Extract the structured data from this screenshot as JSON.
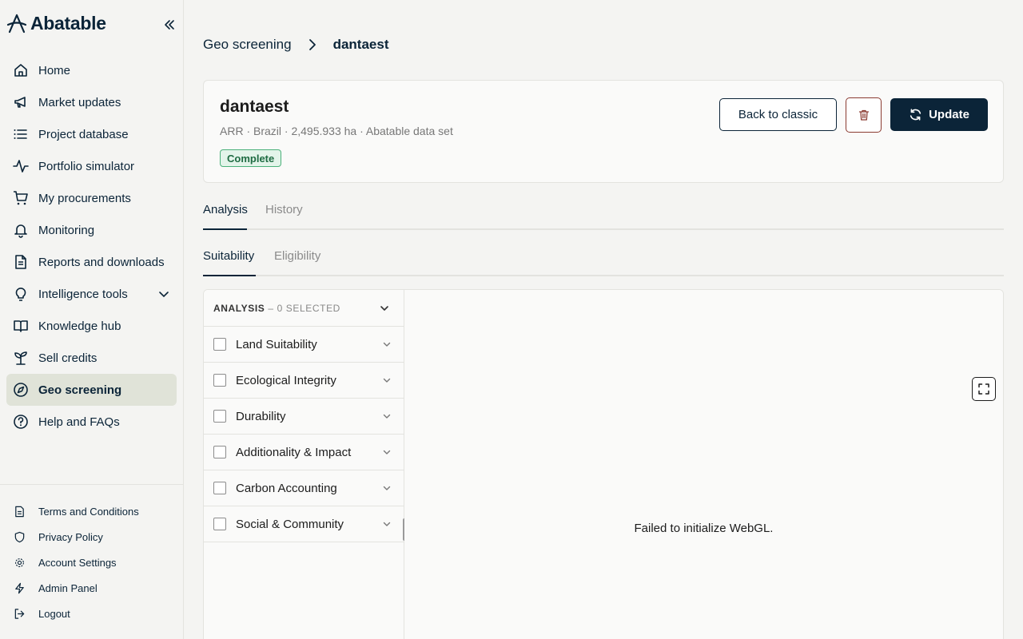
{
  "brand": {
    "name": "Abatable"
  },
  "sidebar": {
    "items": [
      {
        "label": "Home",
        "icon": "home-icon"
      },
      {
        "label": "Market updates",
        "icon": "megaphone-icon"
      },
      {
        "label": "Project database",
        "icon": "list-icon"
      },
      {
        "label": "Portfolio simulator",
        "icon": "activity-icon"
      },
      {
        "label": "My procurements",
        "icon": "cart-icon"
      },
      {
        "label": "Monitoring",
        "icon": "bell-icon"
      },
      {
        "label": "Reports and downloads",
        "icon": "document-icon"
      },
      {
        "label": "Intelligence tools",
        "icon": "lightbulb-icon"
      },
      {
        "label": "Knowledge hub",
        "icon": "book-icon"
      },
      {
        "label": "Sell credits",
        "icon": "sprout-icon"
      },
      {
        "label": "Geo screening",
        "icon": "compass-icon",
        "active": true
      },
      {
        "label": "Help and FAQs",
        "icon": "help-icon"
      }
    ],
    "footer": [
      {
        "label": "Terms and Conditions",
        "icon": "document-icon"
      },
      {
        "label": "Privacy Policy",
        "icon": "shield-icon"
      },
      {
        "label": "Account Settings",
        "icon": "gear-icon"
      },
      {
        "label": "Admin Panel",
        "icon": "lightning-icon"
      },
      {
        "label": "Logout",
        "icon": "logout-icon"
      }
    ]
  },
  "breadcrumb": {
    "parent": "Geo screening",
    "current": "dantaest"
  },
  "project": {
    "title": "dantaest",
    "meta": "ARR · Brazil · 2,495.933 ha · Abatable data set",
    "status": "Complete",
    "back_label": "Back to classic",
    "update_label": "Update"
  },
  "tabs": {
    "primary": [
      "Analysis",
      "History"
    ],
    "secondary": [
      "Suitability",
      "Eligibility"
    ]
  },
  "analysis": {
    "header_label": "ANALYSIS",
    "selected_text": "– 0 SELECTED",
    "categories": [
      "Land Suitability",
      "Ecological Integrity",
      "Durability",
      "Additionality & Impact",
      "Carbon Accounting",
      "Social & Community"
    ]
  },
  "map": {
    "error": "Failed to initialize WebGL."
  },
  "colors": {
    "primary": "#0b2438",
    "active_nav": "#e0e3d8",
    "badge_green": "#4bb07a",
    "danger": "#8a3a30"
  }
}
